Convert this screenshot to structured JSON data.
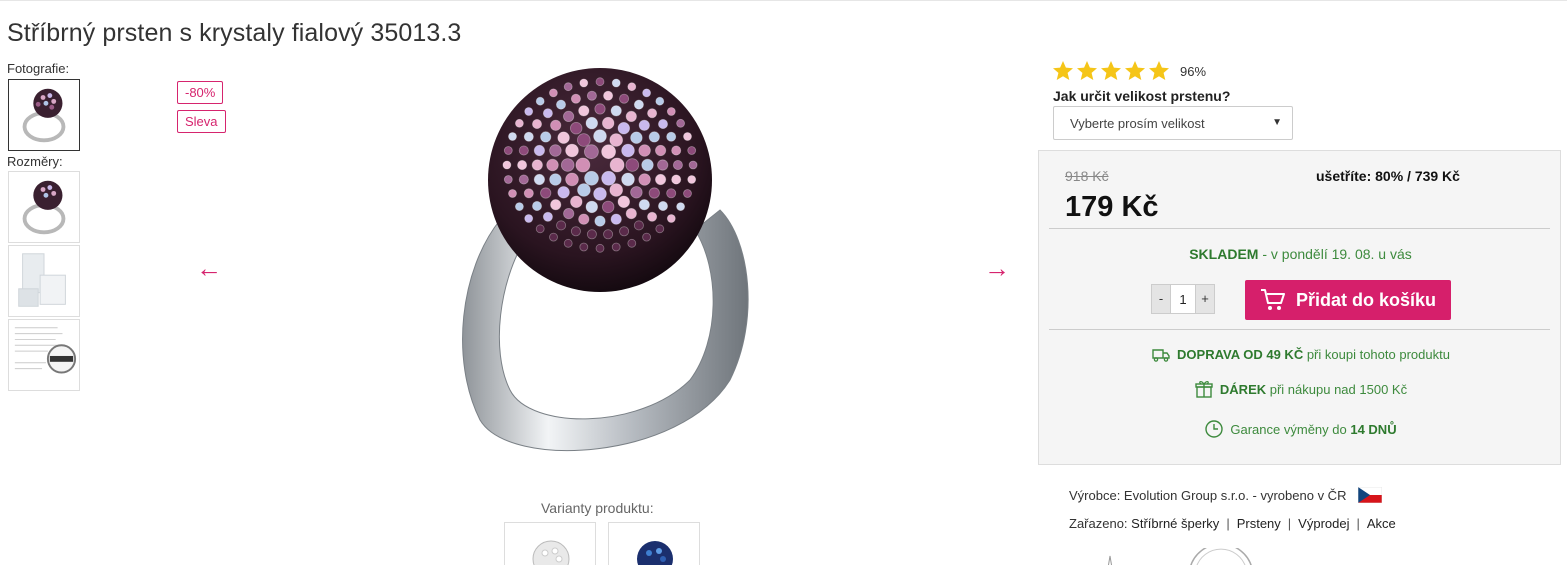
{
  "product": {
    "title": "Stříbrný prsten s krystaly fialový 35013.3"
  },
  "gallery": {
    "photos_label": "Fotografie:",
    "sizes_label": "Rozměry:",
    "badges": [
      "-80%",
      "Sleva"
    ],
    "prev_arrow": "←",
    "next_arrow": "→"
  },
  "variants": {
    "label": "Varianty produktu:"
  },
  "rating": {
    "stars": 5,
    "percent": "96%"
  },
  "size": {
    "question": "Jak určit velikost prstenu?",
    "placeholder": "Vyberte prosím velikost"
  },
  "pricing": {
    "old_price": "918 Kč",
    "savings": "ušetříte: 80% / 739 Kč",
    "price": "179 Kč",
    "stock_status": "SKLADEM",
    "stock_delivery": " - v pondělí 19. 08. u vás",
    "quantity": "1",
    "minus": "-",
    "plus": "+",
    "add_to_cart": "Přidat do košíku"
  },
  "benefits": {
    "shipping_strong": "DOPRAVA OD 49 KČ",
    "shipping_rest": " při koupi tohoto produktu",
    "gift_strong": "DÁREK",
    "gift_rest": " při nákupu nad 1500 Kč",
    "guarantee_pre": "Garance výměny do ",
    "guarantee_strong": "14 DNŮ"
  },
  "meta": {
    "manufacturer": "Výrobce: Evolution Group s.r.o. - vyrobeno v ČR",
    "category_label": "Zařazeno: ",
    "categories": [
      "Stříbrné šperky",
      "Prsteny",
      "Výprodej",
      "Akce"
    ]
  },
  "colors": {
    "accent": "#d61f6b",
    "green": "#3d8a3d",
    "star": "#f5c518"
  }
}
